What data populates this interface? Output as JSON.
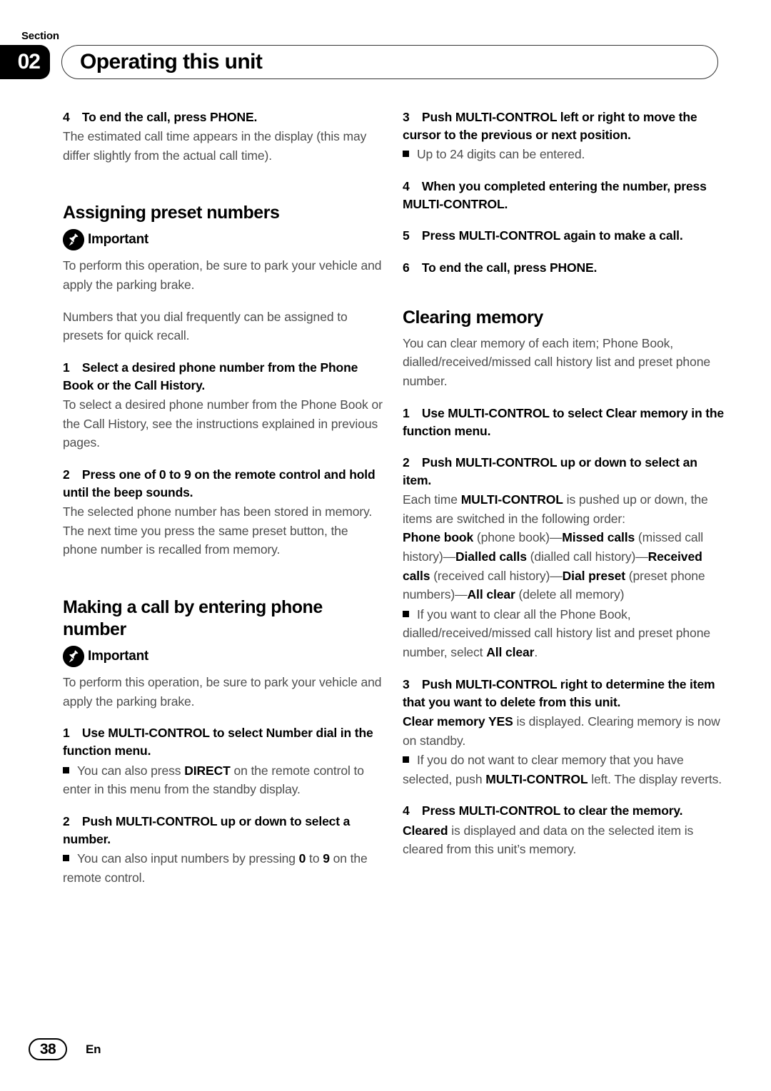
{
  "header": {
    "section_label": "Section",
    "section_number": "02",
    "title": "Operating this unit"
  },
  "footer": {
    "page_number": "38",
    "language": "En"
  },
  "icons": {
    "important_icon_name": "pushpin-icon",
    "bullet_marker": "filled-square-bullet"
  },
  "left_column": {
    "step4_end_call": "4 To end the call, press PHONE.",
    "step4_body": "The estimated call time appears in the display (this may differ slightly from the actual call time).",
    "heading_assigning": "Assigning preset numbers",
    "important_label_1": "Important",
    "important_body_1": "To perform this operation, be sure to park your vehicle and apply the parking brake.",
    "intro_presets": "Numbers that you dial frequently can be assigned to presets for quick recall.",
    "step1_select": "1 Select a desired phone number from the Phone Book or the Call History.",
    "step1_body": "To select a desired phone number from the Phone Book or the Call History, see the instructions explained in previous pages.",
    "step2_press": "2 Press one of 0 to 9 on the remote control and hold until the beep sounds.",
    "step2_body": "The selected phone number has been stored in memory. The next time you press the same preset button, the phone number is recalled from memory.",
    "heading_making_call": "Making a call by entering phone number",
    "important_label_2": "Important",
    "important_body_2": "To perform this operation, be sure to park your vehicle and apply the parking brake.",
    "step1_use_mc": "1 Use MULTI-CONTROL to select Number dial in the function menu.",
    "bullet_direct_a": "You can also press ",
    "bullet_direct_b": "DIRECT",
    "bullet_direct_c": " on the remote control to enter in this menu from the standby display.",
    "step2_push_mc": "2 Push MULTI-CONTROL up or down to select a number.",
    "bullet_input_a": "You can also input numbers by pressing ",
    "bullet_input_b": "0",
    "bullet_input_c": " to ",
    "bullet_input_d": "9",
    "bullet_input_e": " on the remote control."
  },
  "right_column": {
    "step3_push": "3 Push MULTI-CONTROL left or right to move the cursor to the previous or next position.",
    "bullet_digits": "Up to 24 digits can be entered.",
    "step4_completed": "4 When you completed entering the number, press MULTI-CONTROL.",
    "step5_press_again": "5 Press MULTI-CONTROL again to make a call.",
    "step6_end_call": "6 To end the call, press PHONE.",
    "heading_clearing": "Clearing memory",
    "clearing_body": "You can clear memory of each item; Phone Book, dialled/received/missed call history list and preset phone number.",
    "step1_use_mc": "1 Use MULTI-CONTROL to select Clear memory in the function menu.",
    "step2_push_mc": "2 Push MULTI-CONTROL up or down to select an item.",
    "order_intro_a": "Each time ",
    "order_intro_b": "MULTI-CONTROL",
    "order_intro_c": " is pushed up or down, the items are switched in the following order:",
    "order_1_bold": "Phone book",
    "order_1_plain": " (phone book)—",
    "order_2_bold": "Missed calls",
    "order_2_plain": " (missed call history)—",
    "order_3_bold": "Dialled calls",
    "order_3_plain": " (dialled call history)—",
    "order_4_bold": "Received calls",
    "order_4_plain": " (received call history)—",
    "order_5_bold": "Dial preset",
    "order_5_plain": " (preset phone numbers)—",
    "order_6_bold": "All clear",
    "order_6_plain": " (delete all memory)",
    "bullet_allclear_a": "If you want to clear all the Phone Book, dialled/received/missed call history list and preset phone number, select ",
    "bullet_allclear_b": "All clear",
    "bullet_allclear_c": ".",
    "step3_push_right": "3 Push MULTI-CONTROL right to determine the item that you want to delete from this unit.",
    "step3_body_a": "Clear memory YES",
    "step3_body_b": " is displayed. Clearing memory is now on standby.",
    "bullet_revert_a": "If you do not want to clear memory that you have selected, push ",
    "bullet_revert_b": "MULTI-CONTROL",
    "bullet_revert_c": " left. The display reverts.",
    "step4_press_mc": "4 Press MULTI-CONTROL to clear the memory.",
    "step4_body_a": "Cleared",
    "step4_body_b": " is displayed and data on the selected item is cleared from this unit’s memory."
  }
}
